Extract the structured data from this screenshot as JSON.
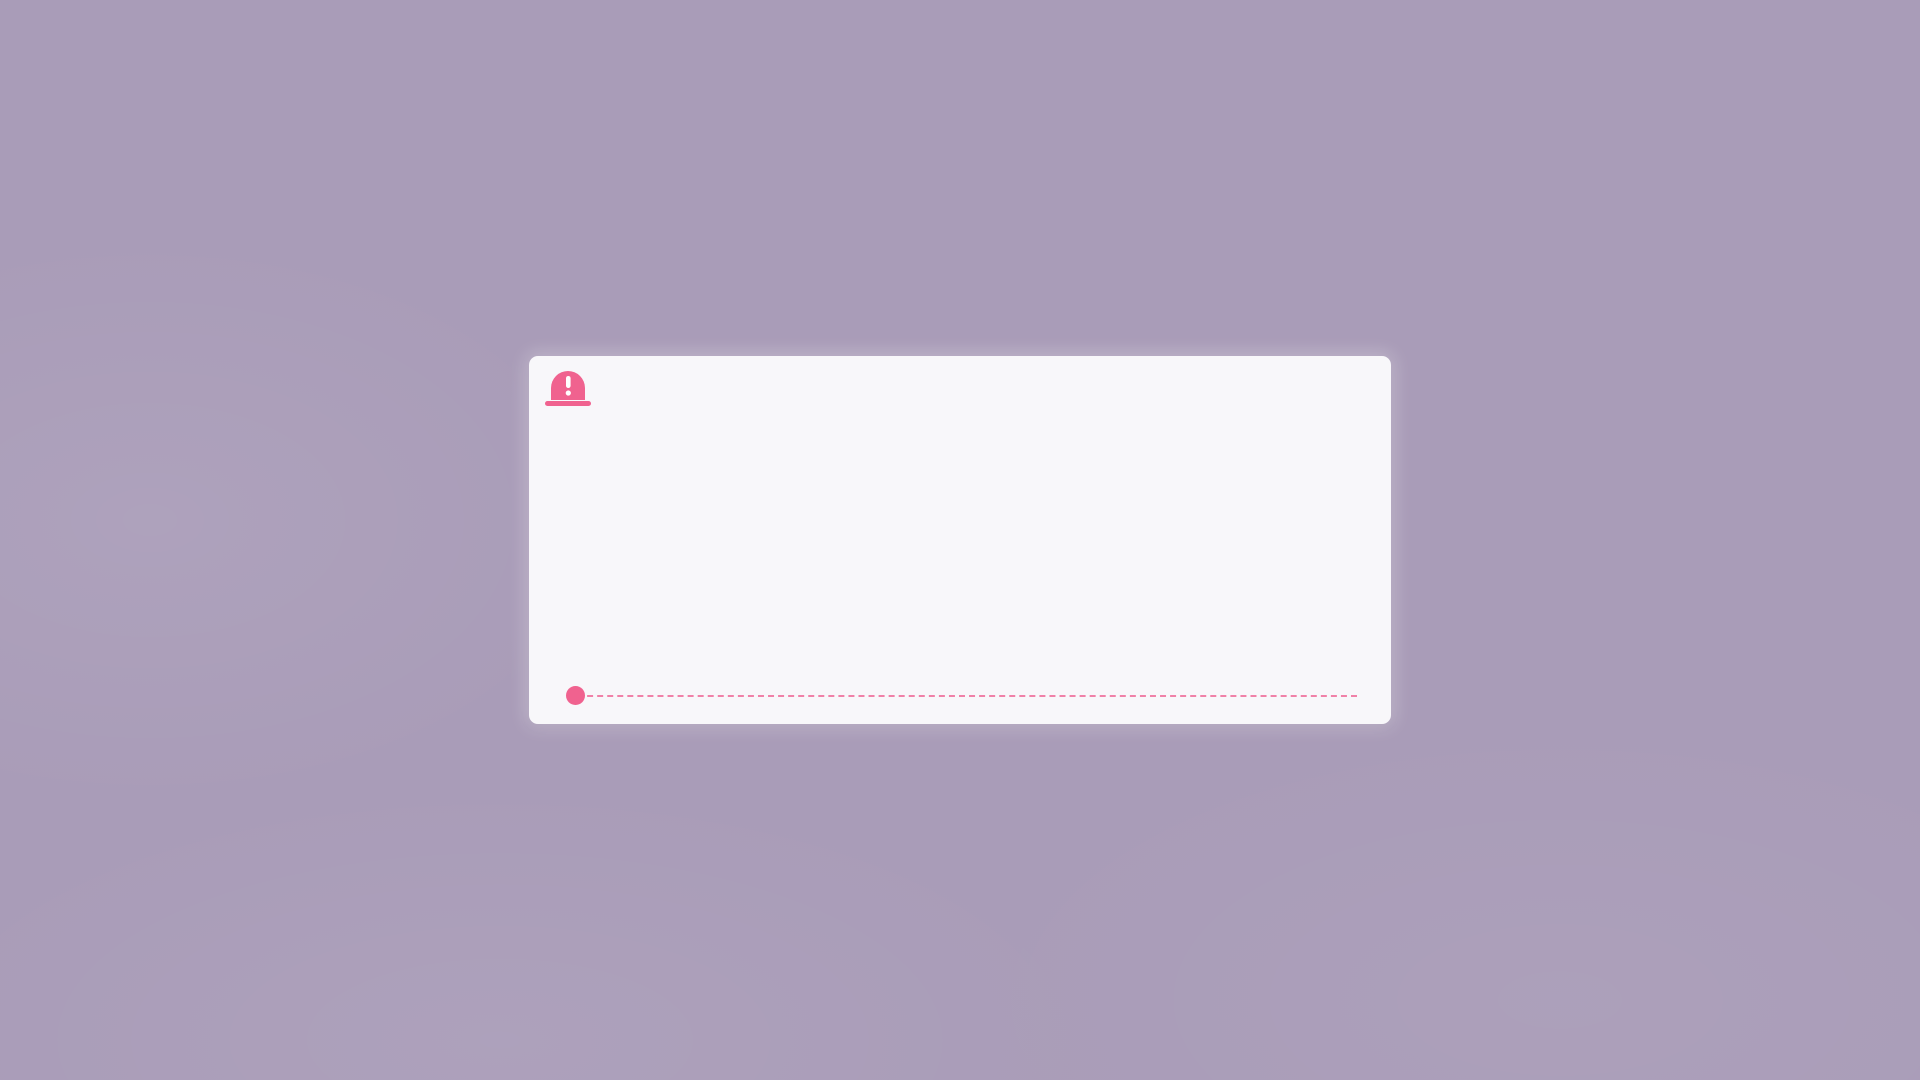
{
  "dialog": {
    "icon": "siren-alert-icon",
    "accent_color": "#f0628f",
    "message": "",
    "progress": {
      "value": 0,
      "track_style": "dashed"
    }
  }
}
